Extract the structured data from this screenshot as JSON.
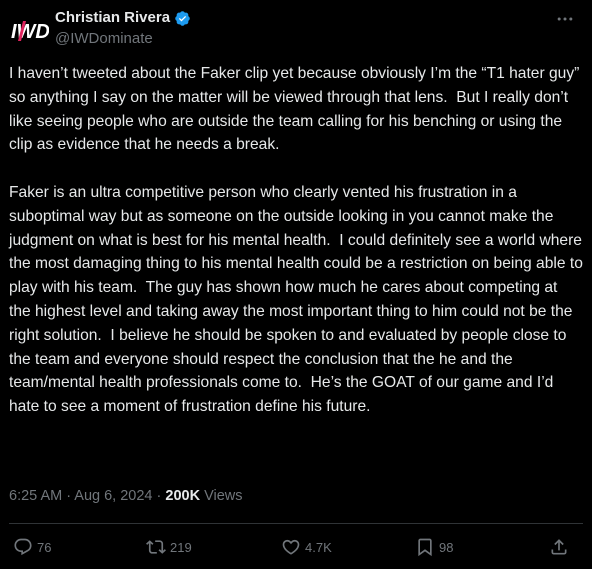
{
  "author": {
    "display_name": "Christian Rivera",
    "handle": "@IWDominate",
    "verified": true,
    "avatar_logo": "IWD"
  },
  "post": {
    "paragraphs": [
      "I haven’t tweeted about the Faker clip yet because obviously I’m the “T1 hater guy” so anything I say on the matter will be viewed through that lens.  But I really don’t like seeing people who are outside the team calling for his benching or using the clip as evidence that he needs a break.",
      "Faker is an ultra competitive person who clearly vented his frustration in a suboptimal way but as someone on the outside looking in you cannot make the judgment on what is best for his mental health.  I could definitely see a world where the most damaging thing to his mental health could be a restriction on being able to play with his team.  The guy has shown how much he cares about competing at the highest level and taking away the most important thing to him could not be the right solution.  I believe he should be spoken to and evaluated by people close to the team and everyone should respect the conclusion that the he and the team/mental health professionals come to.  He’s the GOAT of our game and I’d hate to see a moment of frustration define his future."
    ],
    "timestamp": "6:25 AM · Aug 6, 2024 · ",
    "views_count": "200K",
    "views_label": " Views"
  },
  "actions": {
    "replies": "76",
    "reposts": "219",
    "likes": "4.7K",
    "bookmarks": "98"
  },
  "colors": {
    "background": "#000000",
    "text": "#e7e9ea",
    "muted": "#71767b",
    "verified": "#1d9bf0",
    "divider": "#2f3336",
    "logo_accent": "#e0245e"
  },
  "icons": {
    "avatar": "iwd-logo-icon",
    "verified": "verified-badge-icon",
    "more": "more-horizontal-icon",
    "reply": "reply-icon",
    "repost": "repost-icon",
    "like": "heart-icon",
    "bookmark": "bookmark-icon",
    "share": "share-icon"
  }
}
